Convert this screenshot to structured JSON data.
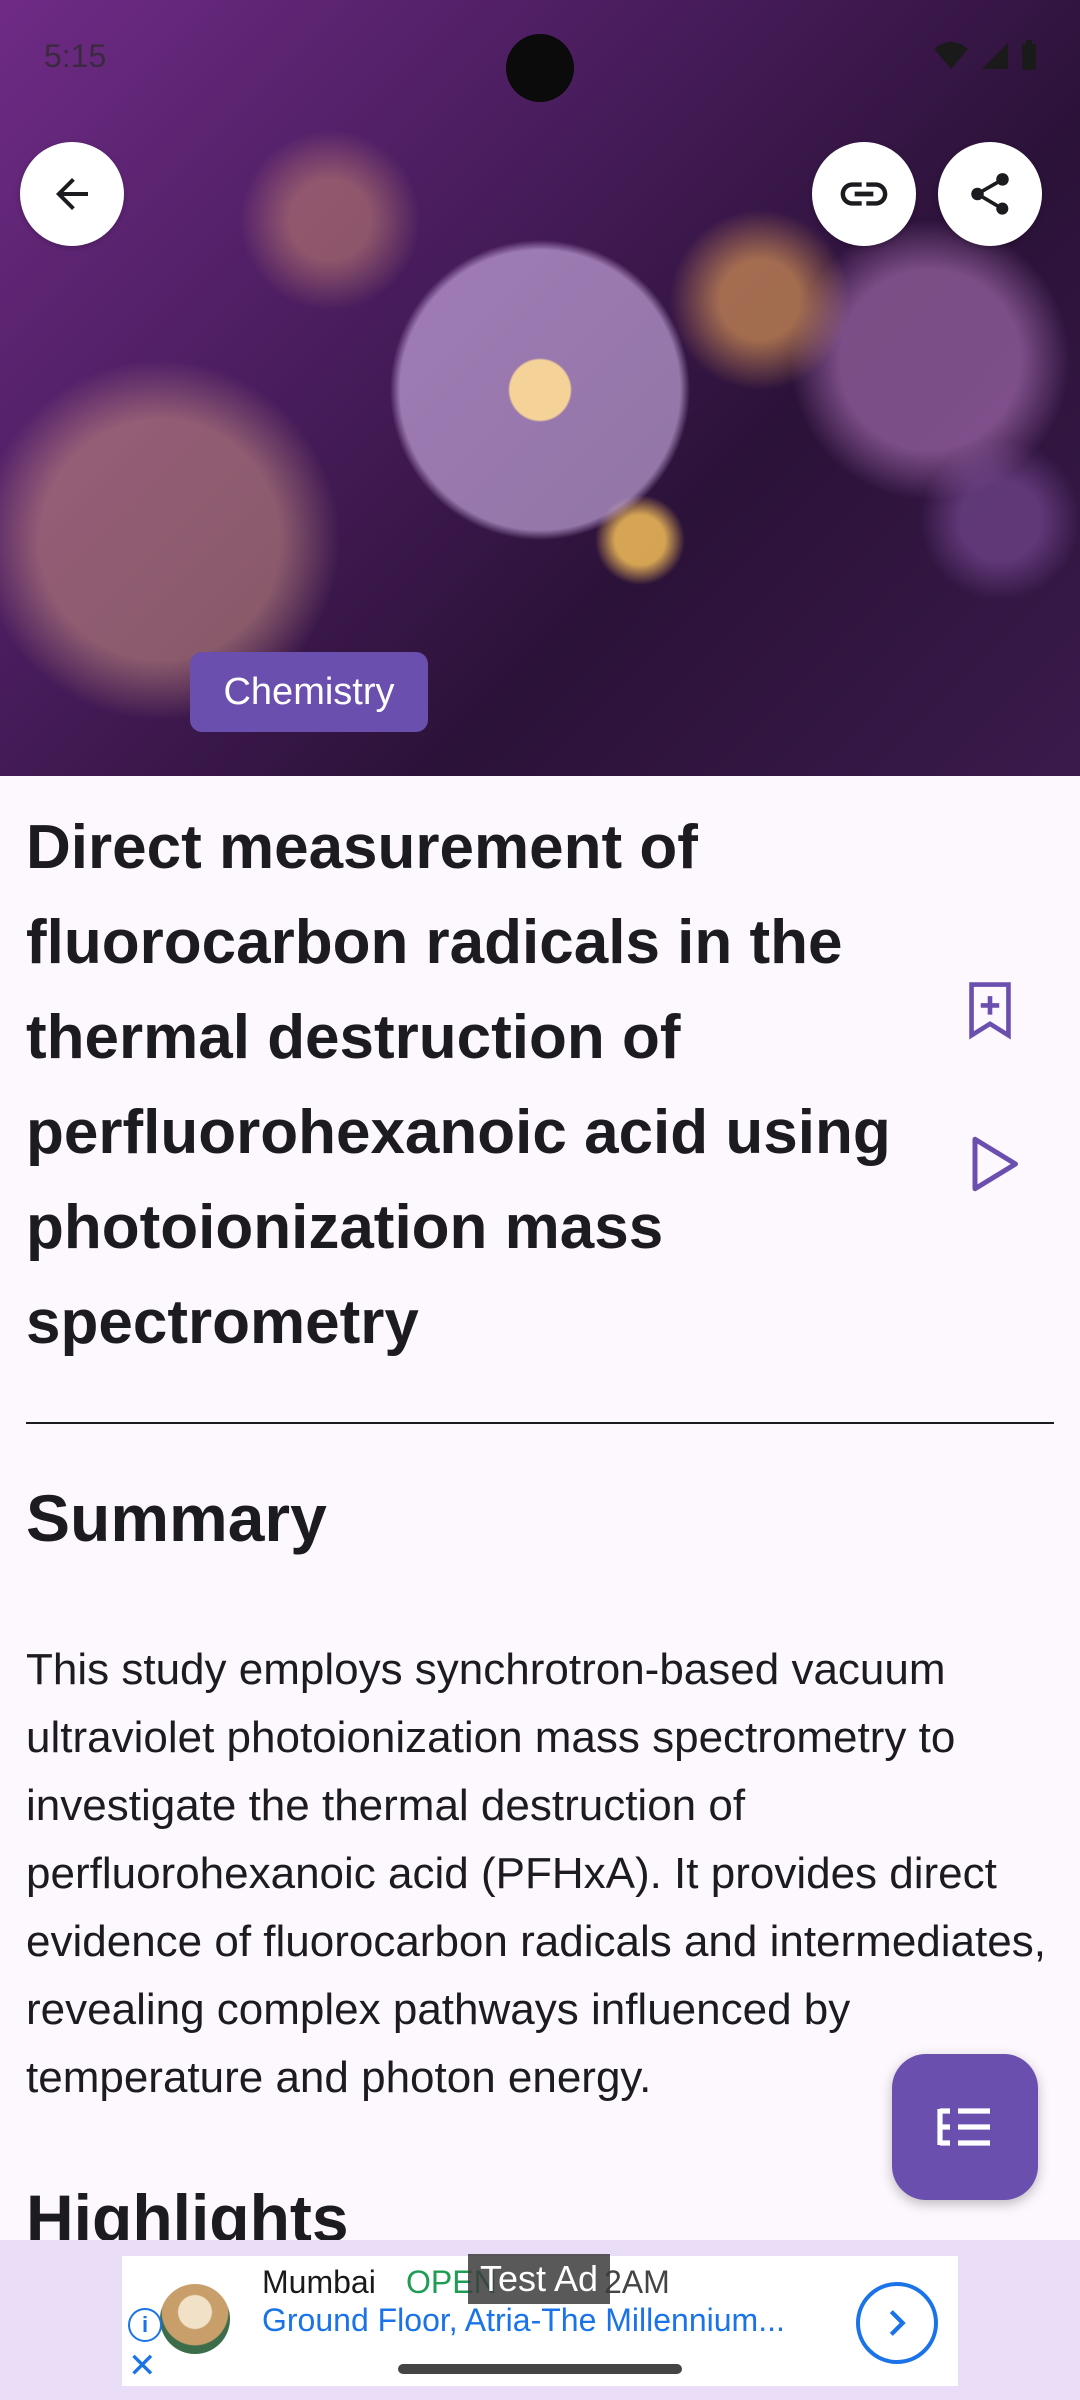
{
  "status_bar": {
    "time": "5:15"
  },
  "hero": {
    "category_chip": "Chemistry"
  },
  "article": {
    "title": "Direct measurement of fluorocarbon radicals in the thermal destruction of perfluorohexanoic acid using photoionization mass spectrometry",
    "summary_heading": "Summary",
    "summary_text": "This study employs synchrotron-based vacuum ultraviolet photoionization mass spectrometry to investigate the thermal destruction of perfluorohexanoic acid (PFHxA). It provides direct evidence of fluorocarbon radicals and intermediates, revealing complex pathways influenced by temperature and photon energy.",
    "highlights_heading": "Highlights"
  },
  "ad": {
    "label": "Test Ad",
    "city": "Mumbai",
    "open_status": "OPEN",
    "hours_tail": "2AM",
    "address": "Ground Floor, Atria-The Millennium..."
  },
  "colors": {
    "accent": "#6A4FAF",
    "background": "#FDF7FE",
    "ad_link": "#1A73E8"
  }
}
